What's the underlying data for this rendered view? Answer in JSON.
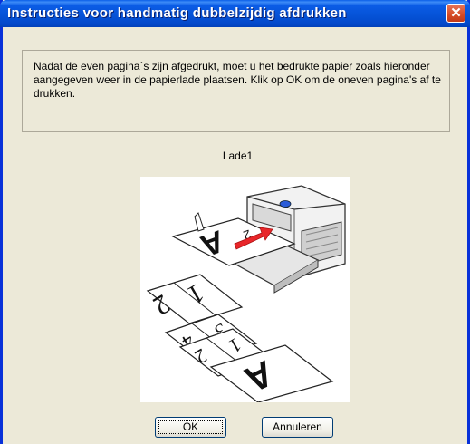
{
  "window": {
    "title": "Instructies voor handmatig dubbelzijdig afdrukken",
    "close_glyph": "✕"
  },
  "message": "Nadat de even pagina´s zijn afgedrukt, moet u het bedrukte papier zoals hieronder aangegeven weer in de papierlade plaatsen. Klik op OK om de oneven pagina's af te drukken.",
  "tray_label": "Lade1",
  "illustration": {
    "icon": "printer-tray-illustration",
    "page_glyphs": [
      "A",
      "2",
      "1",
      "4",
      "3",
      "2",
      "1",
      "A"
    ]
  },
  "buttons": {
    "ok_label": "OK",
    "cancel_label": "Annuleren"
  },
  "colors": {
    "titlebar": "#0552d6",
    "dialog_bg": "#ece9d8",
    "arrow_red": "#e8262a",
    "close_red": "#d54a25"
  }
}
